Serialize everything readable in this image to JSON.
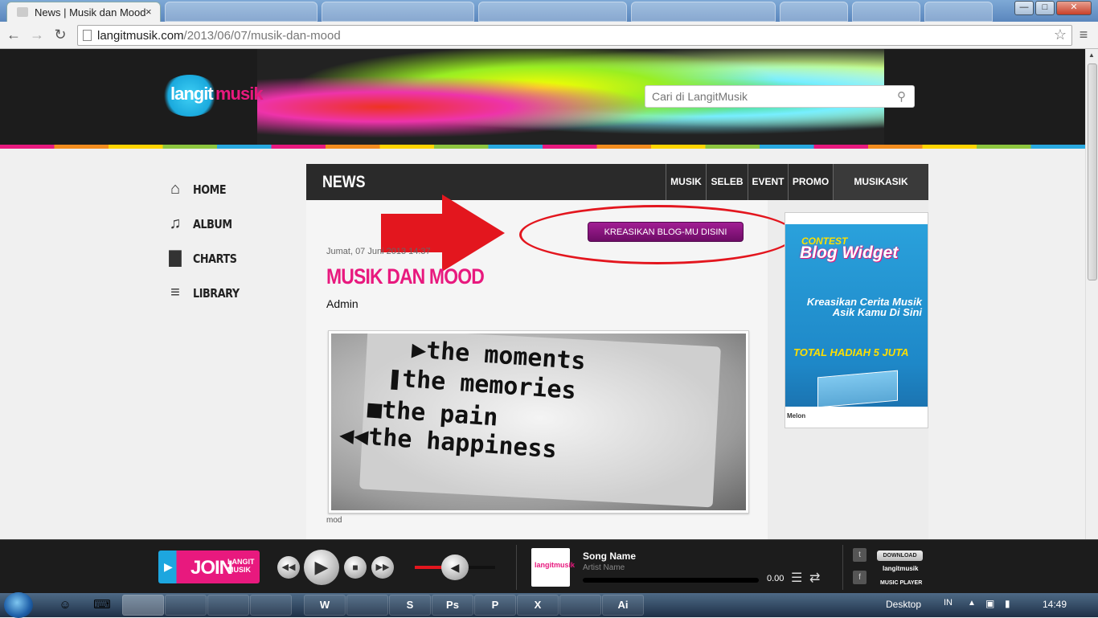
{
  "browser": {
    "active_tab_title": "News | Musik dan Mood",
    "background_tabs": [
      "",
      "",
      "",
      "",
      "",
      "",
      ""
    ],
    "url_host": "langitmusik.com",
    "url_path": "/2013/06/07/musik-dan-mood",
    "window_controls": {
      "minimize": "—",
      "maximize": "□",
      "close": "✕"
    }
  },
  "site": {
    "logo_part1": "langit",
    "logo_part2": "musik",
    "search_placeholder": "Cari di LangitMusik",
    "search_icon": "magnifier-icon"
  },
  "side_nav": [
    {
      "label": "HOME",
      "icon": "home-icon",
      "glyph": "⌂"
    },
    {
      "label": "ALBUM",
      "icon": "music-note-icon",
      "glyph": "♫"
    },
    {
      "label": "CHARTS",
      "icon": "bar-chart-icon",
      "glyph": "▇"
    },
    {
      "label": "LIBRARY",
      "icon": "library-icon",
      "glyph": "≡"
    }
  ],
  "news_bar": {
    "title": "NEWS",
    "tabs": [
      "MUSIK",
      "SELEB",
      "EVENT",
      "PROMO",
      "MUSIKASIK CORNER"
    ]
  },
  "article": {
    "cta_button": "KREASIKAN BLOG-MU DISINI",
    "date": "Jumat, 07 Juni 2013 14:37",
    "title": "MUSIK DAN MOOD",
    "author": "Admin",
    "image_lines": [
      "▶the moments",
      "❚the memories",
      "■the pain",
      "◀◀the happiness"
    ],
    "caption": "mod"
  },
  "sidebar_ad": {
    "line1": "CONTEST",
    "line2": "Blog Widget",
    "line3": "Kreasikan Cerita Musik Asik Kamu Di Sini",
    "line4": "TOTAL HADIAH 5 JUTA",
    "footer": "Melon"
  },
  "player": {
    "join_label": "JOIN",
    "join_sub": "LANGIT MUSIK",
    "song_name": "Song Name",
    "artist_name": "Artist Name",
    "time": "0.00",
    "volume_level": 0.35,
    "download_label": "DOWNLOAD",
    "brand": "langitmusik",
    "music_player_label": "MUSIC PLAYER"
  },
  "taskbar": {
    "desktop_label": "Desktop",
    "language": "IN",
    "clock": "14:49",
    "apps": [
      "",
      "",
      "",
      "",
      "W",
      "",
      "S",
      "Ps",
      "P",
      "X",
      "",
      "Ai"
    ]
  },
  "colors": {
    "accent_pink": "#e8197e",
    "accent_blue": "#1da6df",
    "cta_purple": "#8a1480",
    "annotation_red": "#e3161e",
    "header_dark": "#2a2a2a"
  }
}
